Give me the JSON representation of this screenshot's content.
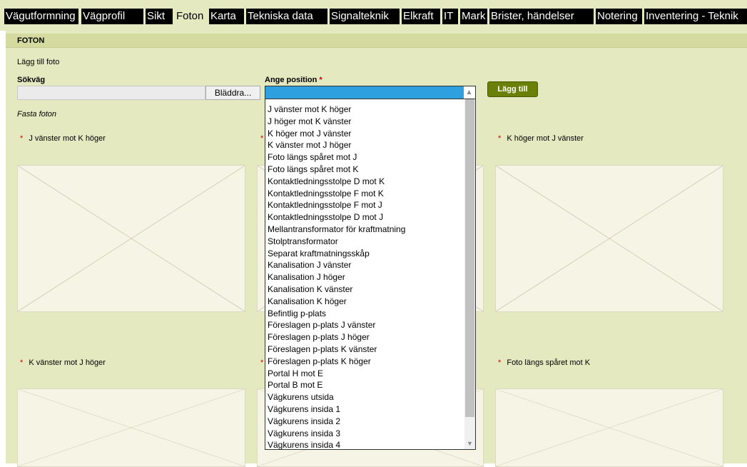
{
  "tabs": [
    {
      "label": "Vägutformning",
      "active": false
    },
    {
      "label": "Vägprofil",
      "active": false
    },
    {
      "label": "Sikt",
      "active": false
    },
    {
      "label": "Foton",
      "active": true
    },
    {
      "label": "Karta",
      "active": false
    },
    {
      "label": "Tekniska data",
      "active": false
    },
    {
      "label": "Signalteknik",
      "active": false
    },
    {
      "label": "Elkraft",
      "active": false
    },
    {
      "label": "IT",
      "active": false
    },
    {
      "label": "Mark",
      "active": false
    },
    {
      "label": "Brister, händelser",
      "active": false
    },
    {
      "label": "Notering",
      "active": false
    },
    {
      "label": "Inventering - Teknik",
      "active": false
    }
  ],
  "section": {
    "title": "FOTON"
  },
  "add_photo": {
    "heading": "Lägg till foto",
    "path_label": "Sökväg",
    "browse_label": "Bläddra...",
    "position_label": "Ange position",
    "required_mark": "*",
    "add_button": "Lägg till"
  },
  "fixed_photos": {
    "heading": "Fasta foton",
    "slots": [
      {
        "label": "J vänster mot K höger"
      },
      {
        "label": "K höger mot J vänster"
      },
      {
        "label": "K vänster mot J höger"
      },
      {
        "label": "Foto längs spåret mot K"
      }
    ]
  },
  "position_options": [
    "J vänster mot K höger",
    "J höger mot K vänster",
    "K höger mot J vänster",
    "K vänster mot J höger",
    "Foto längs spåret mot J",
    "Foto längs spåret mot K",
    "Kontaktledningsstolpe D mot K",
    "Kontaktledningsstolpe F mot K",
    "Kontaktledningsstolpe F mot J",
    "Kontaktledningsstolpe D mot J",
    "Mellantransformator för kraftmatning",
    "Stolptransformator",
    "Separat kraftmatningsskåp",
    "Kanalisation J vänster",
    "Kanalisation J höger",
    "Kanalisation K vänster",
    "Kanalisation K höger",
    "Befintlig p-plats",
    "Föreslagen p-plats J vänster",
    "Föreslagen p-plats J höger",
    "Föreslagen p-plats K vänster",
    "Föreslagen p-plats K höger",
    "Portal H mot E",
    "Portal B mot E",
    "Vägkurens utsida",
    "Vägkurens insida 1",
    "Vägkurens insida 2",
    "Vägkurens insida 3",
    "Vägkurens insida 4"
  ],
  "icons": {
    "select_chevron": "chevron-up-icon",
    "scroll_down": "chevron-down-icon",
    "placeholder": "image-placeholder-icon"
  },
  "colors": {
    "panel_bg": "#e5e9c0",
    "tab_bg": "#000000",
    "add_button_bg": "#6a7f08",
    "selection_blue": "#2ea0e0",
    "required_red": "#cc0000"
  }
}
